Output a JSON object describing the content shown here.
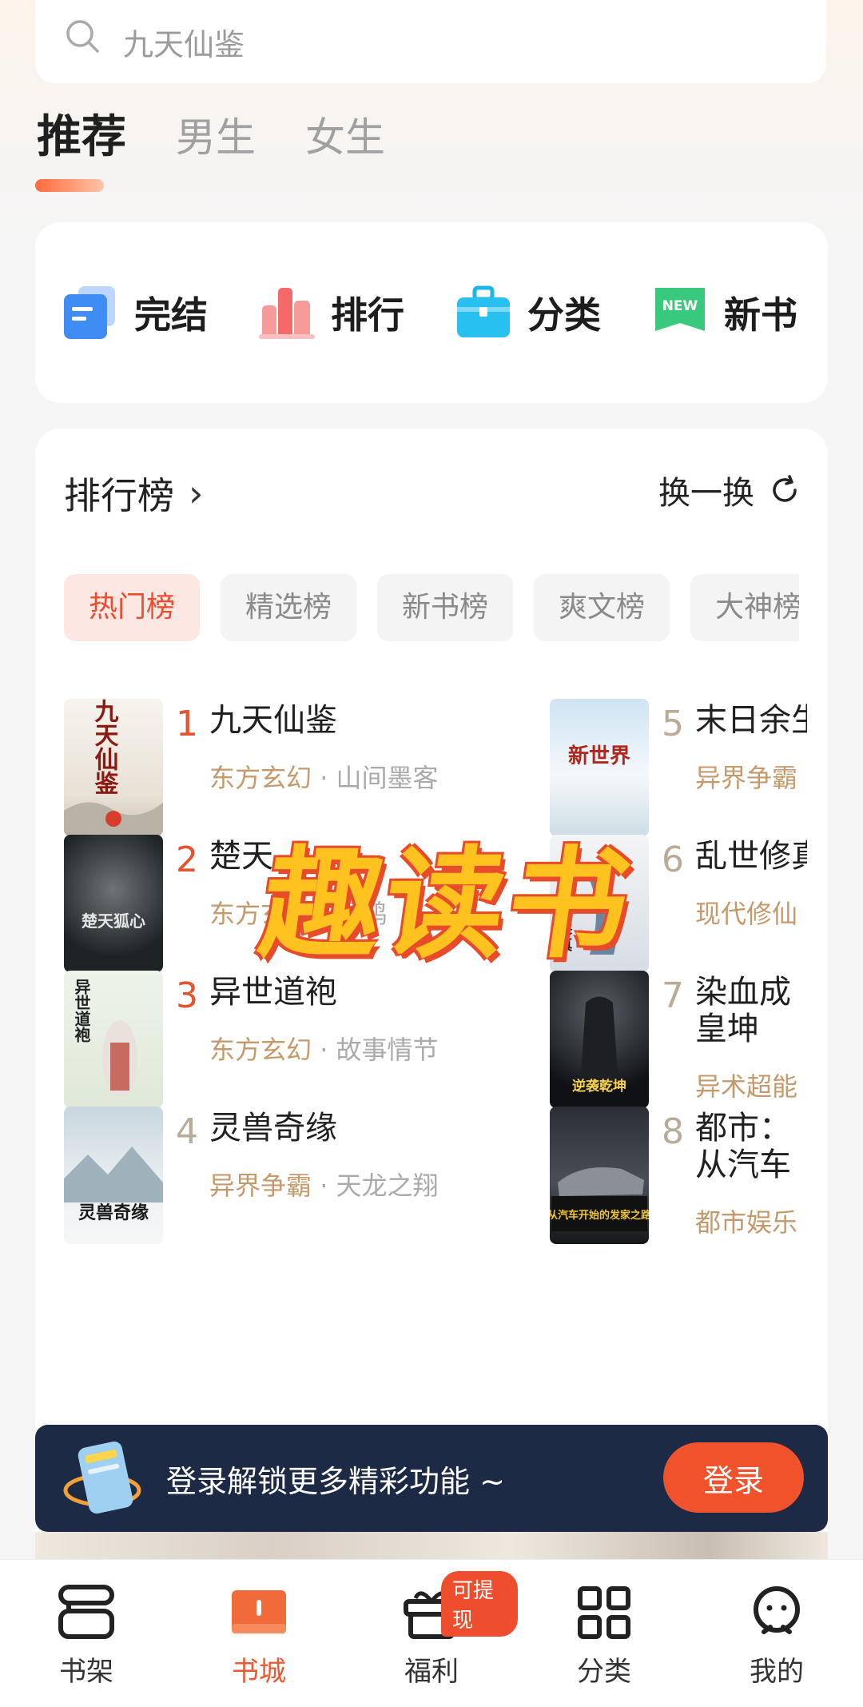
{
  "search": {
    "placeholder": "九天仙鉴"
  },
  "tabs": [
    {
      "label": "推荐"
    },
    {
      "label": "男生"
    },
    {
      "label": "女生"
    }
  ],
  "quick_nav": [
    {
      "label": "完结",
      "icon": "document-stack-icon"
    },
    {
      "label": "排行",
      "icon": "bar-chart-icon"
    },
    {
      "label": "分类",
      "icon": "briefcase-icon"
    },
    {
      "label": "新书",
      "icon": "new-tag-icon",
      "tag": "NEW"
    }
  ],
  "ranking": {
    "title": "排行榜",
    "refresh_label": "换一换",
    "chips": [
      "热门榜",
      "精选榜",
      "新书榜",
      "爽文榜",
      "大神榜"
    ],
    "books_left": [
      {
        "rank": "1",
        "title": "九天仙鉴",
        "category": "东方玄幻",
        "author": "山间墨客"
      },
      {
        "rank": "2",
        "title": "楚天",
        "category": "东方玄幻",
        "author": "雪鸿"
      },
      {
        "rank": "3",
        "title": "异世道袍",
        "category": "东方玄幻",
        "author": "故事情节"
      },
      {
        "rank": "4",
        "title": "灵兽奇缘",
        "category": "异界争霸",
        "author": "天龙之翔"
      }
    ],
    "books_right": [
      {
        "rank": "5",
        "title": "末日余生",
        "category": "异界争霸"
      },
      {
        "rank": "6",
        "title": "乱世修真",
        "category": "现代修仙"
      },
      {
        "rank": "7",
        "title": "染血成皇坤",
        "category": "异术超能"
      },
      {
        "rank": "8",
        "title": "都市：从汽车开始的发家之路",
        "category": "都市娱乐"
      }
    ],
    "cover_titles": [
      "九天仙鉴",
      "楚天狐心",
      "异世道袍",
      "灵兽奇缘",
      "新世界",
      "乱世修真",
      "逆袭乾坤",
      "从汽车开始的发家之路"
    ]
  },
  "watermark": "趣读书",
  "login_bar": {
    "message": "登录解锁更多精彩功能 ~",
    "button": "登录"
  },
  "bottom_nav": [
    {
      "label": "书架"
    },
    {
      "label": "书城"
    },
    {
      "label": "福利",
      "badge": "可提现"
    },
    {
      "label": "分类"
    },
    {
      "label": "我的"
    }
  ],
  "colors": {
    "accent": "#ec5a33",
    "rank_hot": "#e2532f",
    "rank_cold": "#b9ab98",
    "category": "#c49a6c",
    "login_bg": "#1c2a45"
  }
}
